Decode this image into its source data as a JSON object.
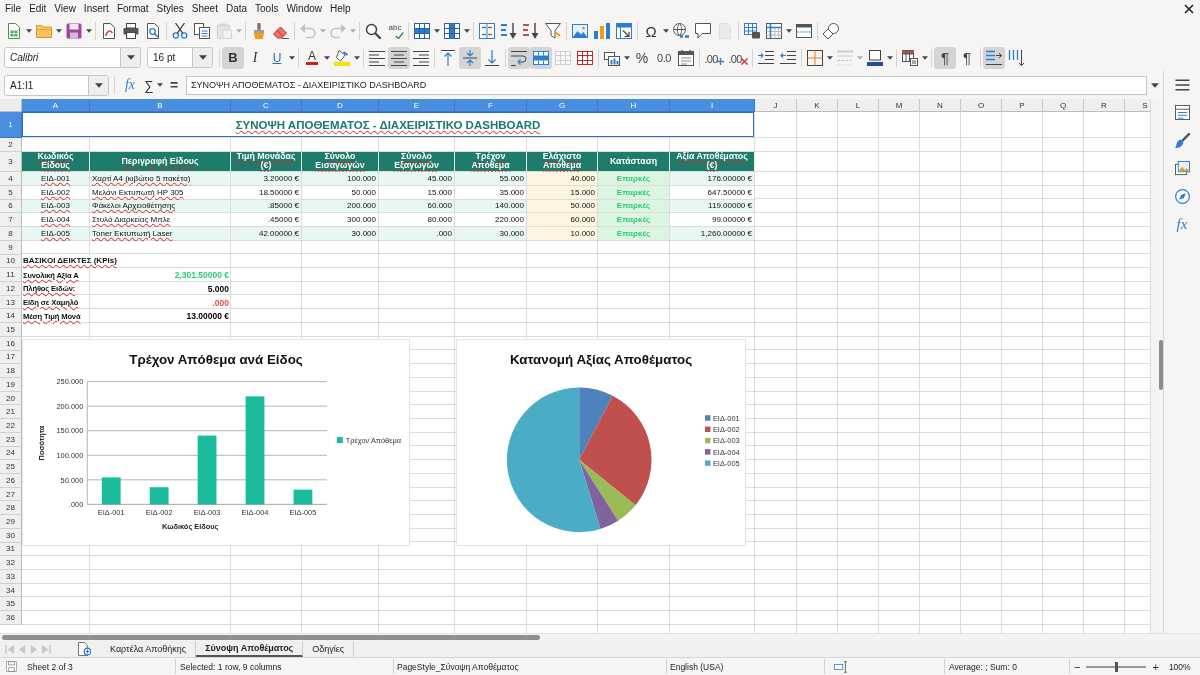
{
  "menu_bar": [
    "File",
    "Edit",
    "View",
    "Insert",
    "Format",
    "Styles",
    "Sheet",
    "Data",
    "Tools",
    "Window",
    "Help"
  ],
  "standard_toolbar": {
    "paste": {
      "disabled": true
    },
    "undo": {
      "disabled": true
    },
    "redo": {
      "disabled": true
    },
    "spelling": {
      "label": "abc"
    },
    "special_character": {
      "label": "Ω"
    },
    "header_footer": {
      "disabled": true
    }
  },
  "formatting_toolbar": {
    "font_name": "Calibri",
    "font_size": "16 pt",
    "bold": {
      "label": "B",
      "on": true
    },
    "italic": {
      "label": "I",
      "on": false
    },
    "underline": {
      "label": "U",
      "on": false
    },
    "font_color": {
      "label": "A"
    },
    "align_left": {
      "on": false
    },
    "align_center": {
      "on": true
    },
    "align_right": {
      "on": false
    },
    "align_top": {
      "on": false
    },
    "align_middle": {
      "on": true
    },
    "align_bottom": {
      "on": false
    },
    "wrap_text": {
      "on": true
    },
    "merge_and_center": {
      "on": true
    },
    "unmerge": {
      "disabled": true
    },
    "percent": {
      "label": "%"
    },
    "number_format": {
      "label": "0.0"
    },
    "add_decimal": {
      "label": ".00"
    },
    "delete_decimal": {
      "label": ".00"
    },
    "border_style": {
      "disabled": true
    },
    "left_to_right": {
      "label": "¶",
      "on": true
    },
    "right_to_left": {
      "label": "¶",
      "on": false
    },
    "horizontal_text": {
      "on": true
    },
    "vertical_text": {
      "on": false
    }
  },
  "formula_bar": {
    "name_box": "A1:I1",
    "function_wizard": "fx",
    "sum": "∑",
    "equals": "=",
    "content": "ΣΥΝΟΨΗ ΑΠΟΘΕΜΑΤΟΣ - ΔΙΑΧΕΙΡΙΣΤΙΚΟ DASHBOARD"
  },
  "sidebar": {
    "functions": "fx"
  },
  "sheet": {
    "auto_spellcheck": true,
    "column_headers": [
      {
        "label": "A",
        "selected": true
      },
      {
        "label": "B",
        "selected": true
      },
      {
        "label": "C",
        "selected": true
      },
      {
        "label": "D",
        "selected": true
      },
      {
        "label": "E",
        "selected": true
      },
      {
        "label": "F",
        "selected": true
      },
      {
        "label": "G",
        "selected": true
      },
      {
        "label": "H",
        "selected": true
      },
      {
        "label": "I",
        "selected": true
      },
      {
        "label": "J",
        "selected": false
      },
      {
        "label": "K",
        "selected": false
      },
      {
        "label": "L",
        "selected": false
      },
      {
        "label": "M",
        "selected": false
      },
      {
        "label": "N",
        "selected": false
      },
      {
        "label": "O",
        "selected": false
      },
      {
        "label": "P",
        "selected": false
      },
      {
        "label": "Q",
        "selected": false
      },
      {
        "label": "R",
        "selected": false
      },
      {
        "label": "S",
        "selected": false
      }
    ],
    "row_headers": [
      {
        "label": "1",
        "selected": true
      },
      {
        "label": "2",
        "selected": false
      },
      {
        "label": "3",
        "selected": false
      },
      {
        "label": "4",
        "selected": false
      },
      {
        "label": "5",
        "selected": false
      },
      {
        "label": "6",
        "selected": false
      },
      {
        "label": "7",
        "selected": false
      },
      {
        "label": "8",
        "selected": false
      },
      {
        "label": "9",
        "selected": false
      },
      {
        "label": "10",
        "selected": false
      },
      {
        "label": "11",
        "selected": false
      },
      {
        "label": "12",
        "selected": false
      },
      {
        "label": "13",
        "selected": false
      },
      {
        "label": "14",
        "selected": false
      },
      {
        "label": "15",
        "selected": false
      },
      {
        "label": "16",
        "selected": false
      },
      {
        "label": "17",
        "selected": false
      },
      {
        "label": "18",
        "selected": false
      },
      {
        "label": "19",
        "selected": false
      },
      {
        "label": "20",
        "selected": false
      },
      {
        "label": "21",
        "selected": false
      },
      {
        "label": "22",
        "selected": false
      },
      {
        "label": "23",
        "selected": false
      },
      {
        "label": "24",
        "selected": false
      },
      {
        "label": "25",
        "selected": false
      },
      {
        "label": "26",
        "selected": false
      },
      {
        "label": "27",
        "selected": false
      },
      {
        "label": "28",
        "selected": false
      },
      {
        "label": "29",
        "selected": false
      },
      {
        "label": "30",
        "selected": false
      },
      {
        "label": "31",
        "selected": false
      },
      {
        "label": "32",
        "selected": false
      },
      {
        "label": "33",
        "selected": false
      },
      {
        "label": "34",
        "selected": false
      },
      {
        "label": "35",
        "selected": false
      },
      {
        "label": "36",
        "selected": false
      }
    ],
    "title": {
      "text": "ΣΥΝΟΨΗ ΑΠΟΘΕΜΑΤΟΣ - ΔΙΑΧΕΙΡΙΣΤΙΚΟ DASHBOARD",
      "selected": true
    },
    "table": {
      "columns": [
        "Κωδικός Είδους",
        "Περιγραφή Είδους",
        "Τιμή Μονάδας (€)",
        "Σύνολο Εισαγωγών",
        "Σύνολο Εξαγωγών",
        "Τρέχον Απόθεμα",
        "Ελάχιστο Απόθεμα",
        "Κατάσταση",
        "Αξία Αποθέματος (€)"
      ],
      "rows": [
        [
          "ΕΙΔ-001",
          "Χαρτί Α4 (κιβώτιο 5 πακέτα)",
          "3.20000 €",
          "100.000",
          "45.000",
          "55.000",
          "40.000",
          "Επαρκές",
          "176.00000 €"
        ],
        [
          "ΕΙΔ-002",
          "Μελάνι Εκτυπωτή HP 305",
          "18.50000 €",
          "50.000",
          "15.000",
          "35.000",
          "15.000",
          "Επαρκές",
          "647.50000 €"
        ],
        [
          "ΕΙΔ-003",
          "Φάκελοι Αρχειοθέτησης",
          ".85000 €",
          "200.000",
          "60.000",
          "140.000",
          "50.000",
          "Επαρκές",
          "119.00000 €"
        ],
        [
          "ΕΙΔ-004",
          "Στυλό Διαρκείας Μπλε",
          ".45000 €",
          "300.000",
          "80.000",
          "220.000",
          "60.000",
          "Επαρκές",
          "99.00000 €"
        ],
        [
          "ΕΙΔ-005",
          "Toner Εκτυπωτή Laser",
          "42.00000 €",
          "30.000",
          ".000",
          "30.000",
          "10.000",
          "Επαρκές",
          "1,260.00000 €"
        ]
      ]
    },
    "kpis": {
      "heading": "ΒΑΣΙΚΟΙ ΔΕΙΚΤΕΣ (KPIs)",
      "items": [
        {
          "label": "Συνολική Αξία Α",
          "value": "2,301.50000 €",
          "color": "#2ecc71"
        },
        {
          "label": "Πλήθος Ειδών:",
          "value": "5.000",
          "color": "#000000"
        },
        {
          "label": "Είδη σε Χαμηλό",
          "value": ".000",
          "color": "#e74c3c"
        },
        {
          "label": "Μέση Τιμή Μονά",
          "value": "13.00000 €",
          "color": "#000000"
        }
      ]
    },
    "charts": [
      {
        "chart_data": {
          "type": "bar",
          "title": "Τρέχον Απόθεμα ανά Είδος",
          "xlabel": "Κωδικός Είδους",
          "ylabel": "Ποσότητα",
          "categories": [
            "ΕΙΔ-001",
            "ΕΙΔ-002",
            "ΕΙΔ-003",
            "ΕΙΔ-004",
            "ΕΙΔ-005"
          ],
          "series": [
            {
              "name": "Τρέχον Απόθεμα",
              "color": "#1abc9c",
              "values": [
                55,
                35,
                140,
                220,
                30
              ]
            }
          ],
          "ylim": [
            0,
            250
          ],
          "yticks": [
            {
              "value": 0,
              "label": ".000"
            },
            {
              "value": 50,
              "label": "50.000"
            },
            {
              "value": 100,
              "label": "100.000"
            },
            {
              "value": 150,
              "label": "150.000"
            },
            {
              "value": 200,
              "label": "200.000"
            },
            {
              "value": 250,
              "label": "250.000"
            }
          ],
          "grid": true,
          "legend": "right"
        }
      },
      {
        "chart_data": {
          "type": "pie",
          "title": "Κατανομή Αξίας Αποθέματος",
          "categories": [
            "ΕΙΔ-001",
            "ΕΙΔ-002",
            "ΕΙΔ-003",
            "ΕΙΔ-004",
            "ΕΙΔ-005"
          ],
          "values": [
            7.65,
            28.13,
            5.17,
            4.3,
            54.75
          ],
          "colors": [
            "#4f81bd",
            "#c0504d",
            "#9bbb59",
            "#8064a2",
            "#4bacc6"
          ],
          "legend": "right"
        }
      }
    ]
  },
  "sheet_tabs": {
    "navigation_disabled": true,
    "tabs": [
      {
        "label": "Καρτέλα Αποθήκης",
        "selected": false
      },
      {
        "label": "Σύνοψη Αποθέματος",
        "selected": true
      },
      {
        "label": "Οδηγίες",
        "selected": false
      }
    ]
  },
  "status_bar": {
    "sheet_position": "Sheet 2 of 3",
    "selection": "Selected: 1 row, 9 columns",
    "page_style": "PageStyle_Σύνοψη Αποθέματος",
    "language": "English (USA)",
    "summary": "Average: ; Sum: 0",
    "zoom_out": "−",
    "zoom_slider": {
      "level": 0.5
    },
    "zoom_in": "+",
    "zoom_percent": "100%"
  }
}
